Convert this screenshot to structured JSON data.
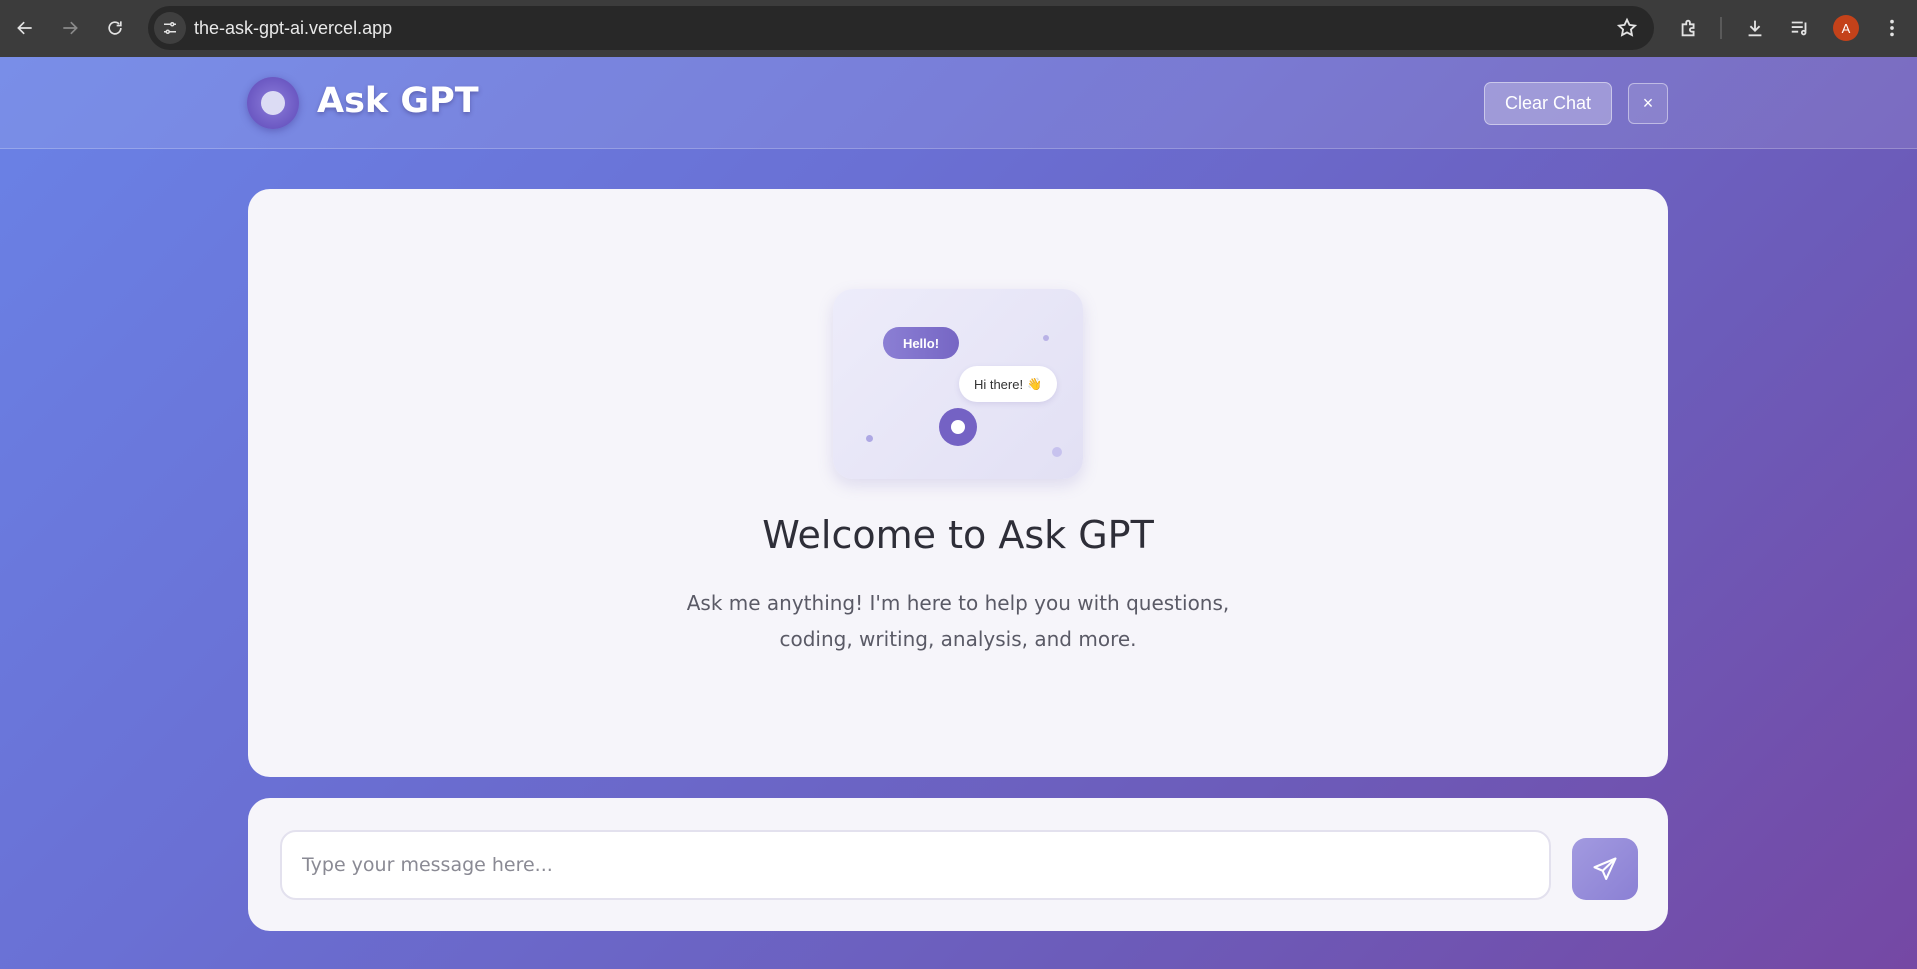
{
  "browser": {
    "url": "the-ask-gpt-ai.vercel.app",
    "profile_initial": "A",
    "icons": [
      "back-icon",
      "forward-icon",
      "reload-icon",
      "site-info-icon",
      "bookmark-star-icon",
      "extensions-icon",
      "download-icon",
      "media-queue-icon",
      "menu-icon"
    ]
  },
  "header": {
    "title": "Ask GPT",
    "clear_label": "Clear Chat",
    "close_label": "×"
  },
  "welcome": {
    "illustration": {
      "bubble_hello": "Hello!",
      "bubble_reply": "Hi there!",
      "reply_emoji": "👋"
    },
    "title": "Welcome to Ask GPT",
    "subtitle": "Ask me anything! I'm here to help you with questions, coding, writing, analysis, and more."
  },
  "composer": {
    "placeholder": "Type your message here...",
    "value": ""
  },
  "colors": {
    "accent": "#7462c4",
    "background_start": "#6a82e6",
    "background_end": "#7548a4",
    "profile": "#c4421a"
  }
}
